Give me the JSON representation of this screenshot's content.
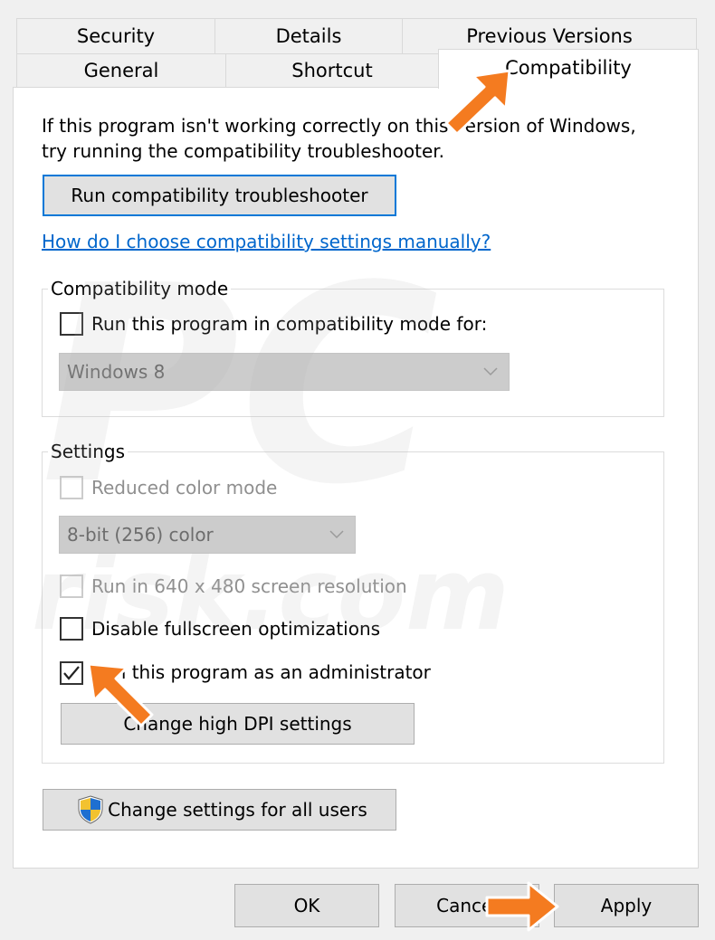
{
  "tabs": {
    "row1": [
      {
        "label": "Security"
      },
      {
        "label": "Details"
      },
      {
        "label": "Previous Versions"
      }
    ],
    "row2": [
      {
        "label": "General"
      },
      {
        "label": "Shortcut"
      },
      {
        "label": "Compatibility",
        "active": true
      }
    ]
  },
  "intro": {
    "line1": "If this program isn't working correctly on this version of Windows,",
    "line2": "try running the compatibility troubleshooter."
  },
  "troubleshooter_button": "Run compatibility troubleshooter",
  "help_link": "How do I choose compatibility settings manually?",
  "compat_mode": {
    "title": "Compatibility mode",
    "checkbox_label": "Run this program in compatibility mode for:",
    "checked": false,
    "os_select": {
      "value": "Windows 8",
      "disabled": true
    }
  },
  "settings": {
    "title": "Settings",
    "reduced_color": {
      "label": "Reduced color mode",
      "checked": false,
      "disabled": true
    },
    "color_select": {
      "value": "8-bit (256) color",
      "disabled": true
    },
    "res_640": {
      "label": "Run in 640 x 480 screen resolution",
      "checked": false,
      "disabled": true
    },
    "disable_fullscreen": {
      "label": "Disable fullscreen optimizations",
      "checked": false
    },
    "run_as_admin": {
      "label": "Run this program as an administrator",
      "checked": true
    },
    "dpi_button": "Change high DPI settings"
  },
  "all_users_button": "Change settings for all users",
  "footer": {
    "ok": "OK",
    "cancel": "Cancel",
    "apply": "Apply"
  },
  "colors": {
    "accent": "#0078d7",
    "link": "#0066cc",
    "arrow": "#f47b20"
  },
  "icons": {
    "shield": "uac-shield-icon",
    "checkmark": "checkmark-icon",
    "dropdown": "chevron-down-icon"
  }
}
